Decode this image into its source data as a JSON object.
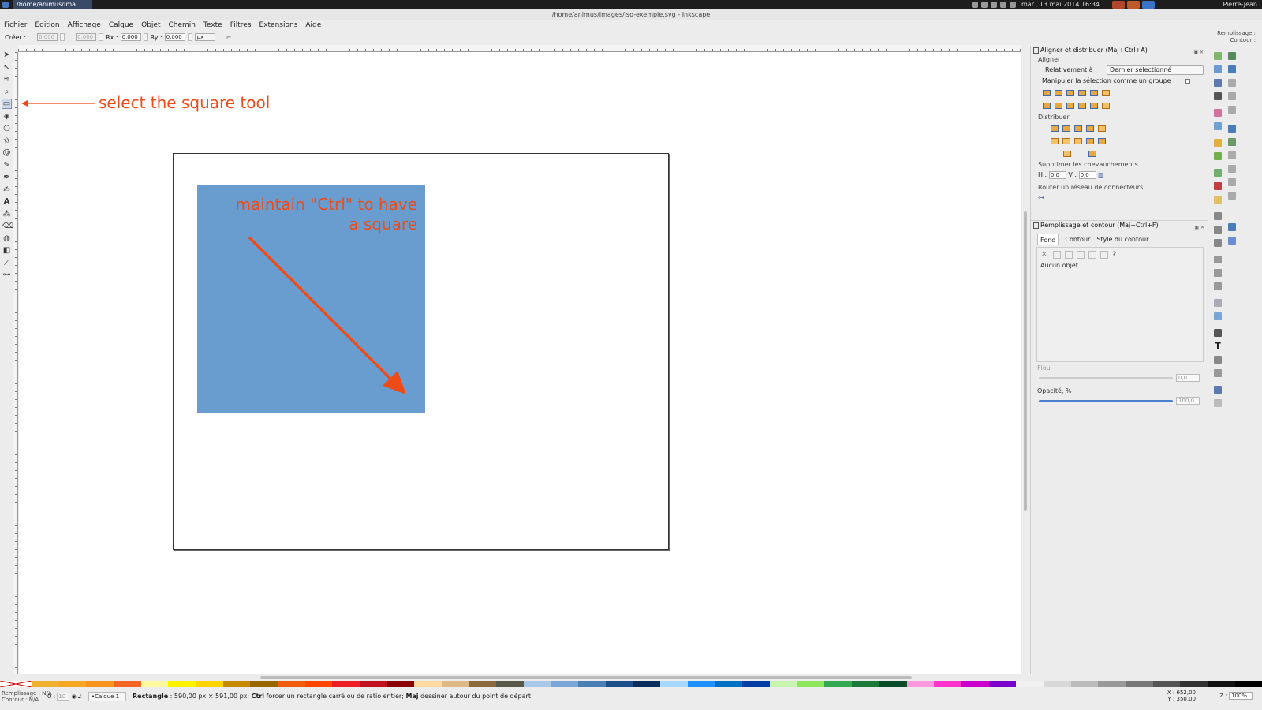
{
  "topbar": {
    "task_title": "/home/animus/Ima...",
    "clock": "mar., 13 mai 2014 16:34",
    "user": "Pierre-Jean"
  },
  "window": {
    "title": "/home/animus/Images/iso-exemple.svg - Inkscape"
  },
  "menu": [
    "Fichier",
    "Édition",
    "Affichage",
    "Calque",
    "Objet",
    "Chemin",
    "Texte",
    "Filtres",
    "Extensions",
    "Aide"
  ],
  "fill_stroke_mini": {
    "fill": "Remplissage :",
    "stroke": "Contour :"
  },
  "toolctrl": {
    "create_label": "Créer :",
    "w_value": "0,000",
    "h_value": "0,000",
    "rx_label": "Rx :",
    "rx_value": "0,000",
    "ry_label": "Ry :",
    "ry_value": "0,000",
    "unit": "px"
  },
  "annotations": {
    "tool": "select the square tool",
    "rect_line1": "maintain \"Ctrl\" to have",
    "rect_line2": "a square",
    "color": "#ed4c19"
  },
  "rect_color": "#699ccf",
  "align_panel": {
    "title": "Aligner et distribuer (Maj+Ctrl+A)",
    "align_section": "Aligner",
    "relative_label": "Relativement à :",
    "relative_value": "Dernier sélectionné",
    "group_label": "Manipuler la sélection comme un groupe :",
    "distribute_section": "Distribuer",
    "overlap_section": "Supprimer les chevauchements",
    "h_label": "H :",
    "h_value": "0,0",
    "v_label": "V :",
    "v_value": "0,0",
    "route_section": "Router un réseau de connecteurs"
  },
  "fill_panel": {
    "title": "Remplissage et contour (Maj+Ctrl+F)",
    "tab_fill": "Fond",
    "tab_stroke": "Contour",
    "tab_stroke_style": "Style du contour",
    "no_object": "Aucun objet",
    "blur_label": "Flou",
    "blur_value": "0,0",
    "opacity_label": "Opacité, %",
    "opacity_value": "100,0"
  },
  "palette": [
    "#f0b030",
    "#f5a623",
    "#f7941d",
    "#f26522",
    "#fff99d",
    "#fff200",
    "#ffd400",
    "#c68a00",
    "#996600",
    "#f25c0f",
    "#ff4500",
    "#ed1c24",
    "#c1121f",
    "#8b0000",
    "#ffd9a0",
    "#deb887",
    "#8b6b3e",
    "#5a5a4a",
    "#a8c8e8",
    "#7aa7d6",
    "#4a7fb5",
    "#1f4e8c",
    "#0b2d5c",
    "#a6d8ff",
    "#1e90ff",
    "#0070c0",
    "#003da5",
    "#c7f5b0",
    "#8ee65a",
    "#32a852",
    "#1b7a3a",
    "#0b4d2a",
    "#ff99dd",
    "#ff33cc",
    "#cc00cc",
    "#7a00cc",
    "#f0f0f0",
    "#d8d8d8",
    "#bbbbbb",
    "#999999",
    "#777777",
    "#555555",
    "#333333",
    "#111111",
    "#000000"
  ],
  "status": {
    "fill_label": "Remplissage :",
    "fill_value": "N/A",
    "stroke_label": "Contour :",
    "stroke_value": "N/A",
    "opacity_label": "O :",
    "opacity_value": "10",
    "layer": "•Calque 1",
    "msg_bold1": "Rectangle",
    "msg_part1": " : 590,00 px × 591,00 px; ",
    "msg_bold2": "Ctrl",
    "msg_part2": " forcer un rectangle carré ou de ratio entier; ",
    "msg_bold3": "Maj",
    "msg_part3": " dessiner autour du point de départ",
    "x_coord": "X : 652,00",
    "y_coord": "Y : 350,00",
    "zoom_label": "Z :",
    "zoom_value": "100%"
  }
}
